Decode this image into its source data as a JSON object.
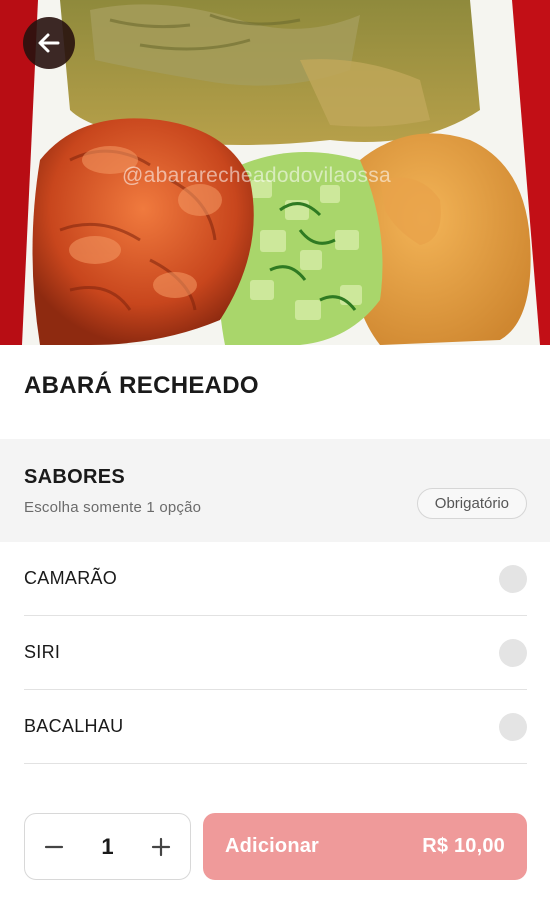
{
  "hero": {
    "watermark": "@abararecheadodovilaossa"
  },
  "product": {
    "title": "ABARÁ RECHEADO"
  },
  "section": {
    "title": "SABORES",
    "subtitle": "Escolha somente 1 opção",
    "badge": "Obrigatório"
  },
  "options": [
    {
      "label": "CAMARÃO",
      "selected": false
    },
    {
      "label": "SIRI",
      "selected": false
    },
    {
      "label": "BACALHAU",
      "selected": false
    }
  ],
  "footer": {
    "quantity": "1",
    "add_label": "Adicionar",
    "price": "R$ 10,00"
  },
  "colors": {
    "accent_disabled": "#ef9a9a",
    "background_red": "#d1121a"
  },
  "icons": {
    "back": "arrow-left-icon",
    "minus": "minus-icon",
    "plus": "plus-icon"
  }
}
